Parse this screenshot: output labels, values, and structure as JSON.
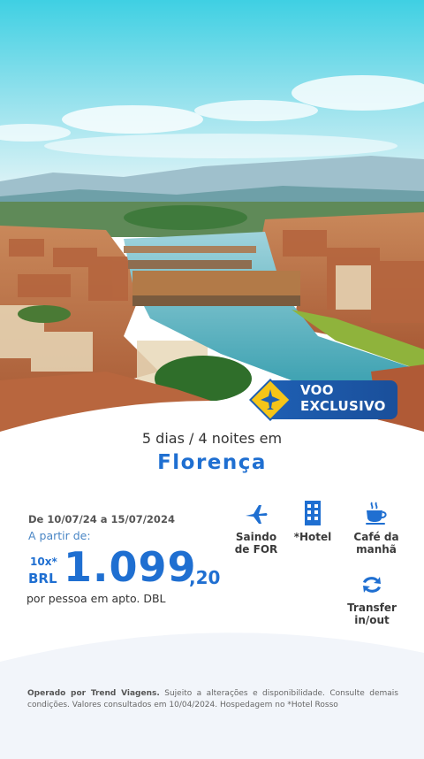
{
  "badge": {
    "line1": "VOO",
    "line2": "EXCLUSIVO",
    "icon": "airplane-icon"
  },
  "headline": "5 dias / 4 noites em",
  "city": "Florença",
  "offer": {
    "dates": "De 10/07/24 a 15/07/2024",
    "from_label": "A partir de:",
    "installments": "10x*",
    "currency": "BRL",
    "price": "1.099",
    "cents": ",20",
    "per_person": "por pessoa em apto. DBL"
  },
  "features": [
    {
      "icon": "airplane-icon",
      "label_1": "Saindo",
      "label_2": "de FOR"
    },
    {
      "icon": "building-icon",
      "label_1": "*Hotel",
      "label_2": ""
    },
    {
      "icon": "coffee-cup-icon",
      "label_1": "Café da",
      "label_2": "manhã"
    },
    {
      "icon": "transfer-arrows-icon",
      "label_1": "Transfer",
      "label_2": "in/out"
    }
  ],
  "footer": {
    "operator": "Operado por Trend Viagens.",
    "text": "Sujeito a alterações e disponibilidade. Consulte demais condições. Valores consultados em 10/04/2024. Hospedagem no *Hotel Rosso"
  },
  "colors": {
    "brand_blue": "#1f6fd1",
    "badge_blue": "#1e5fb3",
    "badge_yellow": "#f5c518"
  }
}
